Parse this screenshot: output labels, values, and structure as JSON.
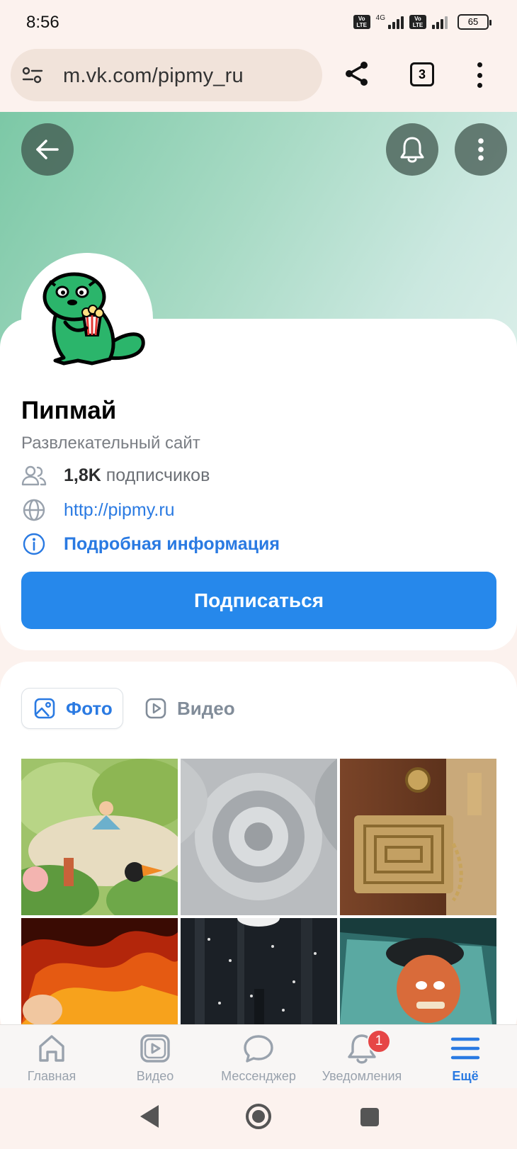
{
  "status_bar": {
    "time": "8:56",
    "network": "4G",
    "volte": "Vo LTE",
    "battery": "65"
  },
  "browser": {
    "url": "m.vk.com/pipmy_ru",
    "tab_count": "3"
  },
  "profile": {
    "name": "Пипмай",
    "subtitle": "Развлекательный сайт",
    "followers_count": "1,8K",
    "followers_suffix": " подписчиков",
    "website": "http://pipmy.ru",
    "details_link": "Подробная информация",
    "subscribe_label": "Подписаться"
  },
  "media_tabs": {
    "photo": "Фото",
    "video": "Видео"
  },
  "photos": [
    {
      "name": "photo-paper-meditation"
    },
    {
      "name": "photo-silver-flower"
    },
    {
      "name": "photo-maze-lock"
    },
    {
      "name": "photo-fire-woman"
    },
    {
      "name": "photo-dark-forest"
    },
    {
      "name": "photo-captain-car"
    }
  ],
  "tabbar": [
    {
      "label": "Главная",
      "icon": "home-icon",
      "active": false
    },
    {
      "label": "Видео",
      "icon": "video-icon",
      "active": false
    },
    {
      "label": "Мессенджер",
      "icon": "messenger-icon",
      "active": false
    },
    {
      "label": "Уведомления",
      "icon": "bell-icon",
      "active": false,
      "badge": "1"
    },
    {
      "label": "Ещё",
      "icon": "menu-icon",
      "active": true
    }
  ],
  "colors": {
    "accent": "#2688eb",
    "link": "#2a7ae2",
    "badge": "#e64646",
    "cover": "#7cc8a6"
  }
}
